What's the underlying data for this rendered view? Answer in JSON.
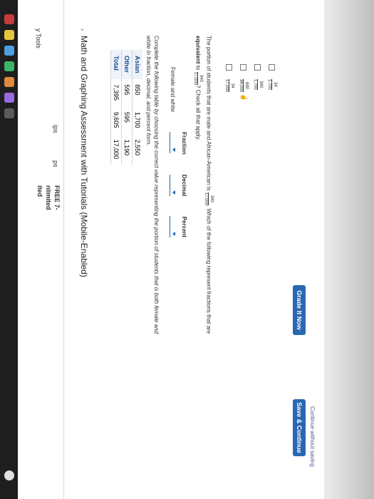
{
  "title": "Math and Graphing Assessment with Tutorials (Mobile-Enabled)",
  "nav": {
    "tools": "y Tools",
    "tips": "ips",
    "tips2": "ps",
    "free1": "FREE 7-",
    "free2": "nlimited",
    "free3": "ited"
  },
  "data_table": {
    "rows": [
      {
        "label": "Asian",
        "c1": "850",
        "c2": "1,700",
        "c3": "2,550"
      },
      {
        "label": "Other",
        "c1": "595",
        "c2": "595",
        "c3": "1,190"
      },
      {
        "label": "Total",
        "c1": "7,395",
        "c2": "9,605",
        "c3": "17,000"
      }
    ]
  },
  "prompt": "Complete the following table by choosing the correct value representing the portion of students that is both female and white in fraction, decimal, and percent form.",
  "answer_table": {
    "headers": [
      "Fraction",
      "Decimal",
      "Percent"
    ],
    "row_label": "Female and white"
  },
  "portion": {
    "text_a": "The portion of students that are male and African-American is",
    "frac_num": "340",
    "frac_den": "17,000",
    "text_b": ". Which of the following represent fractions that are",
    "bold": "equivalent",
    "text_c": "to",
    "text_d": "? Check all that apply."
  },
  "options": [
    {
      "num": "34",
      "den": "17,000"
    },
    {
      "num": "680",
      "den": "34,000"
    },
    {
      "num": "340",
      "den": "1,700"
    },
    {
      "num": "34",
      "den": "1,700"
    }
  ],
  "buttons": {
    "grade": "Grade It Now",
    "save": "Save & Continue",
    "continue": "Continue without saving"
  },
  "colors": {
    "accent": "#2a67b2",
    "dock": "#1e1e1e"
  }
}
